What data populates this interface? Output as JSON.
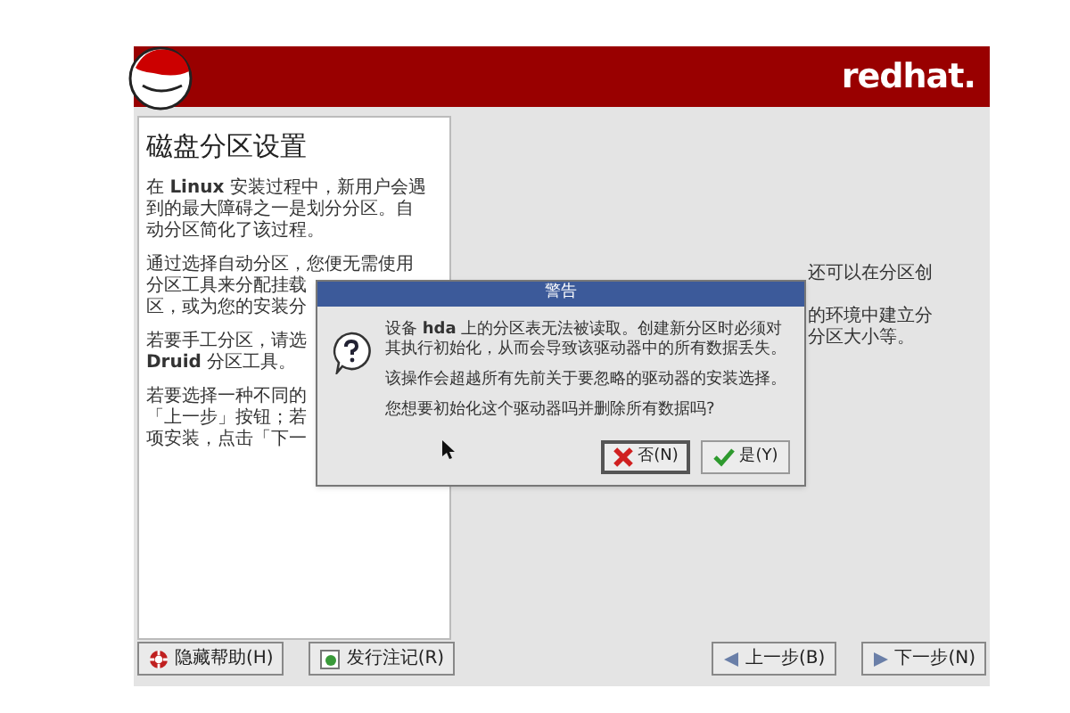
{
  "header": {
    "logo_text": "redhat."
  },
  "help_panel": {
    "title": "磁盘分区设置",
    "paragraphs": [
      {
        "lines": [
          "在 **Linux** 安装过程中，新用户会遇",
          "到的最大障碍之一是划分分区。自",
          "动分区简化了该过程。"
        ]
      },
      {
        "lines": [
          "通过选择自动分区，您便无需使用",
          "分区工具来分配挂载",
          "区，或为您的安装分"
        ]
      },
      {
        "lines": [
          "若要手工分区，请选",
          "**Druid** 分区工具。"
        ]
      },
      {
        "lines": [
          "若要选择一种不同的",
          "「上一步」按钮；若",
          "项安装，点击「下一"
        ]
      }
    ]
  },
  "main_area": {
    "paragraphs": [
      {
        "lines": [
          "还可以在分区创"
        ]
      },
      {
        "lines": [
          "的环境中建立分",
          "分区大小等。"
        ]
      }
    ]
  },
  "dialog": {
    "title": "警告",
    "paragraphs": [
      "设备 **hda** 上的分区表无法被读取。创建新分区时必须对其执行初始化，从而会导致该驱动器中的所有数据丢失。",
      "该操作会超越所有先前关于要忽略的驱动器的安装选择。",
      "您想要初始化这个驱动器吗并删除所有数据吗?"
    ],
    "buttons": [
      {
        "kind": "no",
        "label": "否(N)",
        "focused": true
      },
      {
        "kind": "yes",
        "label": "是(Y)",
        "focused": false
      }
    ]
  },
  "bottom_buttons": [
    {
      "kind": "help",
      "label": "隐藏帮助(H)"
    },
    {
      "kind": "notes",
      "label": "发行注记(R)"
    },
    {
      "kind": "back",
      "label": "上一步(B)"
    },
    {
      "kind": "next",
      "label": "下一步(N)"
    }
  ]
}
